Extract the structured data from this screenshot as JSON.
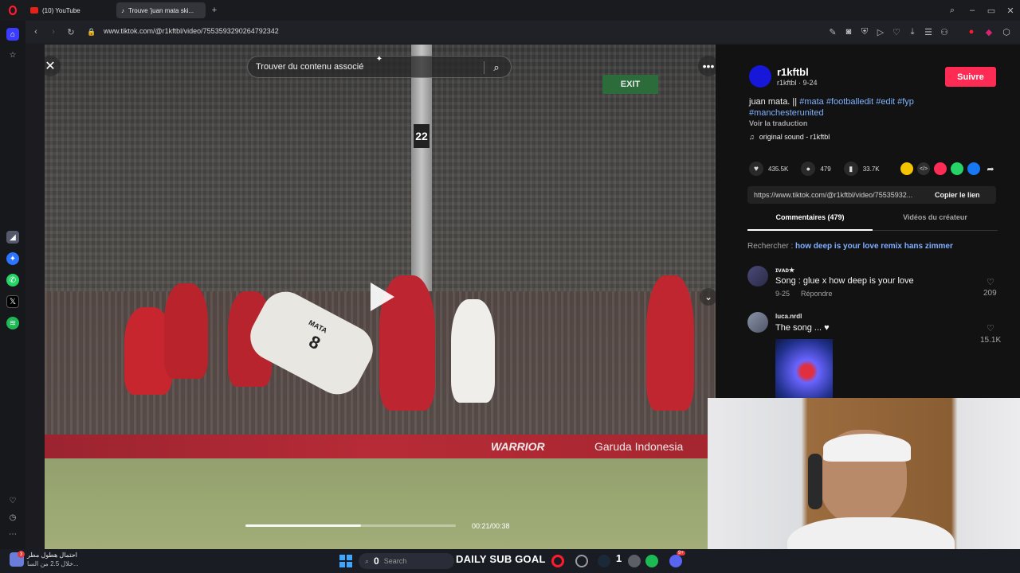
{
  "tabs": [
    {
      "label": "(10) YouTube",
      "color": "#e62117"
    },
    {
      "label": "Trouve 'juan mata ski...",
      "color": "#ffffff"
    }
  ],
  "address": {
    "url": "www.tiktok.com/@r1kftbl/video/7553593290264792342"
  },
  "video": {
    "search_placeholder": "Trouver du contenu associé",
    "time": "00:21/00:38",
    "progress": 0.55,
    "scene_texts": {
      "board_left": "WARRIOR",
      "board_right": "Garuda Indonesia",
      "shirt_name": "MATA",
      "shirt_number": "8",
      "post_number": "22",
      "exit_sign": "EXIT"
    }
  },
  "author": {
    "name": "r1kftbl",
    "handle_date": "r1kftbl · 9-24",
    "follow_label": "Suivre"
  },
  "caption": {
    "text": "juan mata. ||",
    "hashtags_line1": "#mata #footballedit #edit #fyp",
    "hashtags_line2": "#manchesterunited",
    "translate": "Voir la traduction",
    "sound": "original sound - r1kftbl"
  },
  "stats": {
    "likes": "435.5K",
    "comments": "479",
    "saves": "33.7K"
  },
  "share_colors": [
    "#f5c400",
    "#2f2f2f",
    "#fe2c55",
    "#25d366",
    "#1877f2"
  ],
  "link": {
    "url": "https://www.tiktok.com/@r1kftbl/video/75535932...",
    "copy_label": "Copier le lien"
  },
  "panel_tabs": {
    "comments": "Commentaires (479)",
    "creator": "Vidéos du créateur"
  },
  "related_search": {
    "prefix": "Rechercher :",
    "query": "how deep is your love remix hans zimmer"
  },
  "comments": [
    {
      "user": "ɪᴠᴀᴅ★",
      "text": "Song : glue x how deep is your love",
      "date": "9-25",
      "reply": "Répondre",
      "likes": "209"
    },
    {
      "user": "luca.nrdl",
      "text": "The song ... ♥",
      "likes": "15.1K"
    }
  ],
  "taskbar": {
    "notif_line1": "احتمال هطول مطر",
    "notif_line2": "خلال 2.5 من السا...",
    "badge": "3",
    "search_count": "0",
    "search_label": "Search",
    "goal_label": "DAILY SUB GOAL",
    "goal_count": "1",
    "discord_badge": "9+"
  }
}
